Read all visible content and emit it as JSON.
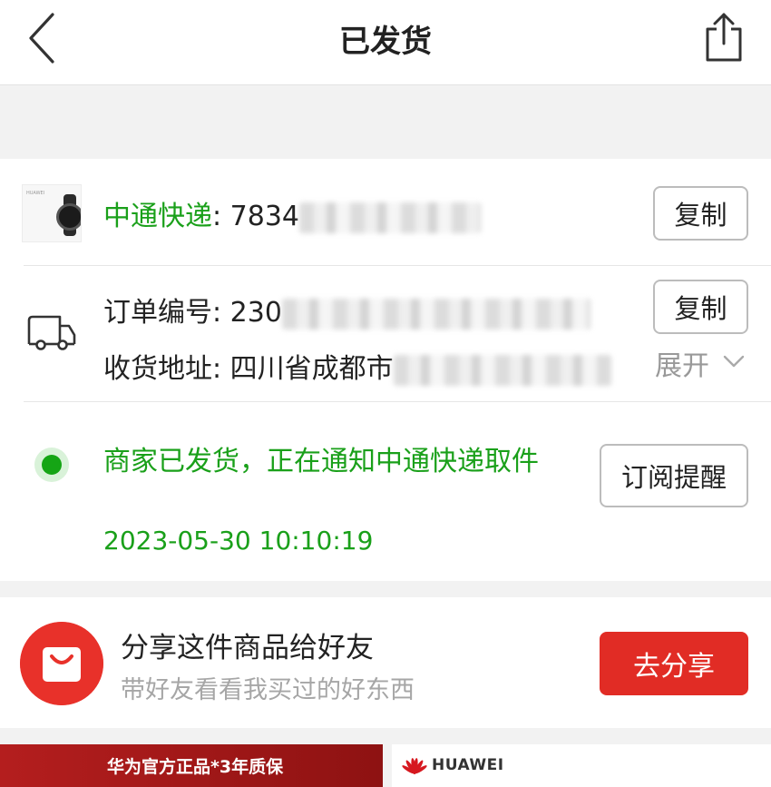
{
  "header": {
    "title": "已发货",
    "back_icon": "chevron-left-icon",
    "share_icon": "share-icon"
  },
  "express": {
    "carrier_label": "中通快递",
    "tracking_prefix": ": 7834",
    "copy_label": "复制"
  },
  "order": {
    "order_label": "订单编号: 230",
    "copy_label": "复制",
    "address_label": "收货地址: 四川省成都市",
    "expand_label": "展开"
  },
  "status": {
    "message": "商家已发货，正在通知中通快递取件",
    "time": "2023-05-30 10:10:19",
    "subscribe_label": "订阅提醒"
  },
  "share": {
    "title": "分享这件商品给好友",
    "subtitle": "带好友看看我买过的好东西",
    "button_label": "去分享"
  },
  "banners": {
    "left_text": "华为官方正品*3年质保",
    "right_brand": "HUAWEI"
  },
  "colors": {
    "green": "#1aa01a",
    "red": "#e12c25"
  }
}
